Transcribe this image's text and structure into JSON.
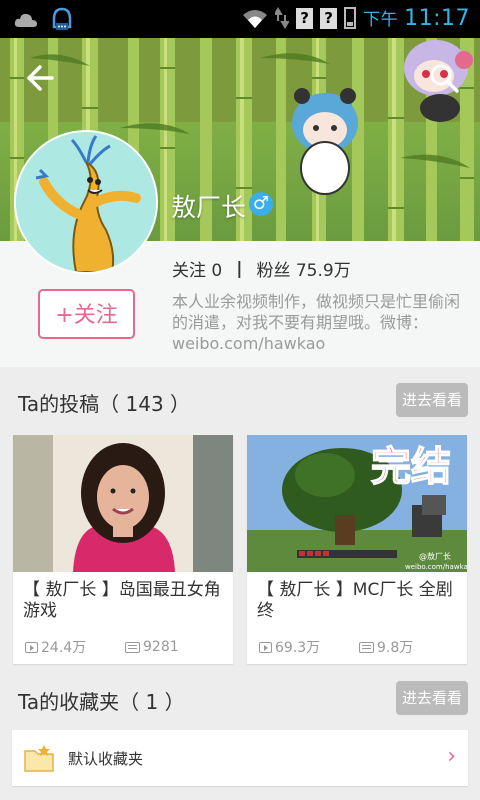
{
  "status_bar": {
    "ampm": "下午",
    "time": "11:17",
    "unknown_a": "?",
    "unknown_b": "?"
  },
  "header": {
    "back_icon": "arrow-left-icon",
    "search_icon": "search-icon"
  },
  "profile": {
    "name": "敖厂长",
    "gender_symbol": "♂",
    "follow_label": "关注",
    "follow_count": "0",
    "fans_label": "粉丝",
    "fans_count": "75.9万",
    "bio": "本人业余视频制作，做视频只是忙里偷闲的消遣，对我不要有期望哦。微博：weibo.com/hawkao",
    "follow_button": "+关注"
  },
  "uploads": {
    "title": "Ta的投稿（ 143 ）",
    "more_button": "进去看看",
    "videos": [
      {
        "title": "【 敖厂长 】岛国最丑女角游戏",
        "plays": "24.4万",
        "danmaku": "9281"
      },
      {
        "title": "【 敖厂长 】MC厂长 全剧终",
        "plays": "69.3万",
        "danmaku": "9.8万",
        "thumb_text": "完结",
        "watermark": "@敖厂长\nweibo.com/hawkao"
      }
    ]
  },
  "favorites": {
    "title": "Ta的收藏夹（ 1 ）",
    "more_button": "进去看看",
    "folders": [
      {
        "label": "默认收藏夹"
      }
    ]
  },
  "colors": {
    "accent": "#e46a8d",
    "status_time": "#33b5e5",
    "more_button_bg": "#bbbbbb"
  }
}
